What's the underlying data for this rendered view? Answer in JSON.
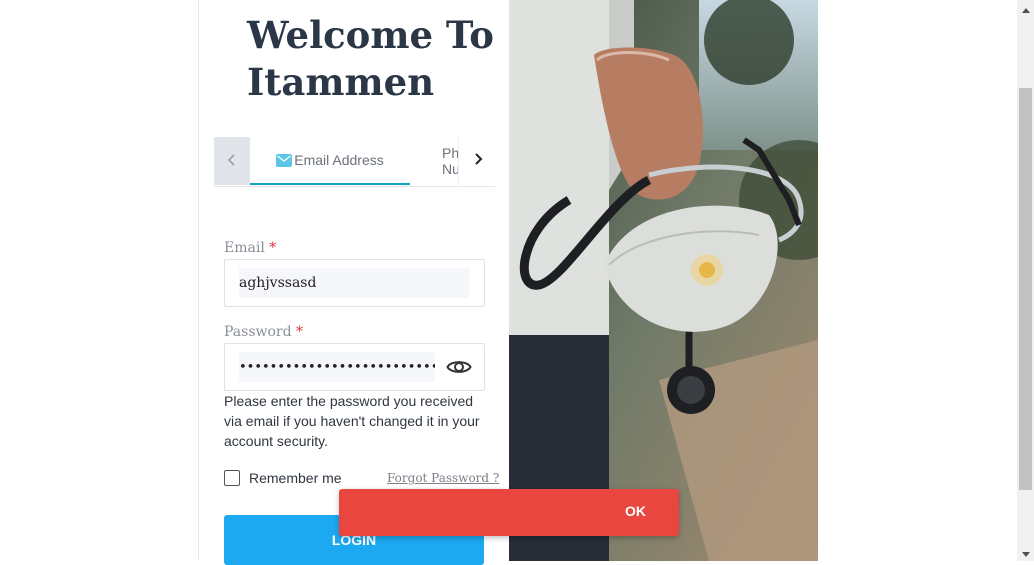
{
  "welcome": {
    "line1": "Welcome To",
    "line2": "Itammen"
  },
  "tabs": {
    "email_label": "Email Address",
    "phone_label": "Phone Number"
  },
  "form": {
    "email_label": "Email",
    "email_value": "aghjvssasd",
    "password_label": "Password",
    "password_value": "•••••••••••••••••••••••••••••",
    "required_mark": "*",
    "help_text": "Please enter the password you received via email if you haven't changed it in your account security.",
    "remember_label": "Remember me",
    "forgot_label": "Forgot Password ?",
    "login_label": "LOGIN"
  },
  "toast": {
    "ok_label": "OK"
  },
  "colors": {
    "accent": "#1aa3c8",
    "login_button": "#1da9f2",
    "toast": "#e9463f",
    "title": "#2b3647"
  },
  "icons": [
    "chevron-left-icon",
    "mail-icon",
    "phone-icon",
    "chevron-right-icon",
    "eye-icon",
    "scroll-up-icon",
    "scroll-down-icon"
  ]
}
